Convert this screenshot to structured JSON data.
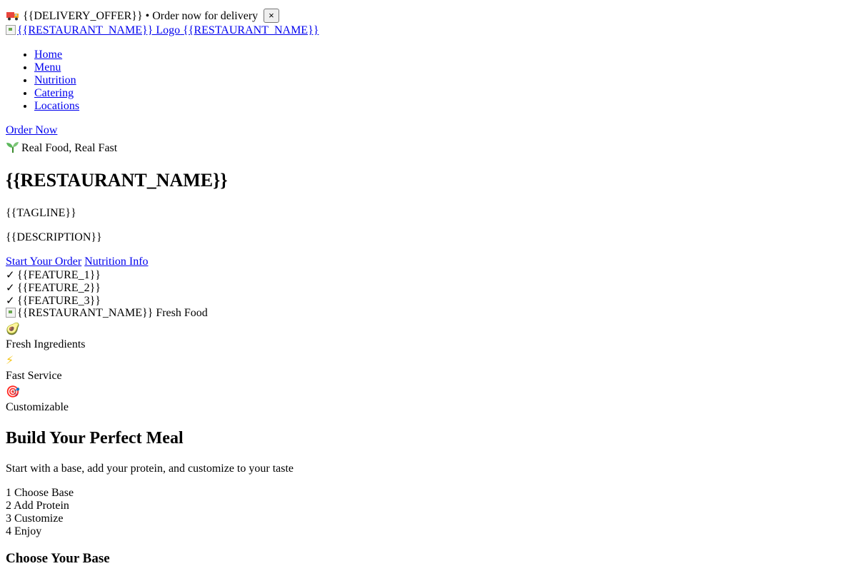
{
  "banner": {
    "icon": "delivery-truck-icon",
    "offer": "{{DELIVERY_OFFER}}",
    "text": "• Order now for delivery",
    "close_label": "×"
  },
  "brand": {
    "logo_alt": "{{RESTAURANT_NAME}} Logo",
    "name": "{{RESTAURANT_NAME}}"
  },
  "nav": {
    "items": [
      {
        "label": "Home"
      },
      {
        "label": "Menu"
      },
      {
        "label": "Nutrition"
      },
      {
        "label": "Catering"
      },
      {
        "label": "Locations"
      }
    ],
    "order_now": "Order Now"
  },
  "hero": {
    "badge_icon": "seedling-icon",
    "badge_text": "Real Food, Real Fast",
    "title": "{{RESTAURANT_NAME}}",
    "tagline": "{{TAGLINE}}",
    "description": "{{DESCRIPTION}}",
    "primary_cta": "Start Your Order",
    "secondary_cta": "Nutrition Info",
    "check_glyph": "✓",
    "features": [
      "{{FEATURE_1}}",
      "{{FEATURE_2}}",
      "{{FEATURE_3}}"
    ],
    "image_alt": "{{RESTAURANT_NAME}} Fresh Food"
  },
  "highlights": [
    {
      "icon": "avocado-icon",
      "glyph": "🥑",
      "label": "Fresh Ingredients"
    },
    {
      "icon": "lightning-icon",
      "glyph": "⚡",
      "label": "Fast Service"
    },
    {
      "icon": "target-icon",
      "glyph": "🎯",
      "label": "Customizable"
    }
  ],
  "builder": {
    "title": "Build Your Perfect Meal",
    "subtitle": "Start with a base, add your protein, and customize to your taste",
    "steps": [
      {
        "number": "1",
        "label": "Choose Base"
      },
      {
        "number": "2",
        "label": "Add Protein"
      },
      {
        "number": "3",
        "label": "Customize"
      },
      {
        "number": "4",
        "label": "Enjoy"
      }
    ],
    "section_title": "Choose Your Base"
  },
  "colors": {
    "link": "#0000ee",
    "text": "#000000",
    "background": "#ffffff"
  }
}
